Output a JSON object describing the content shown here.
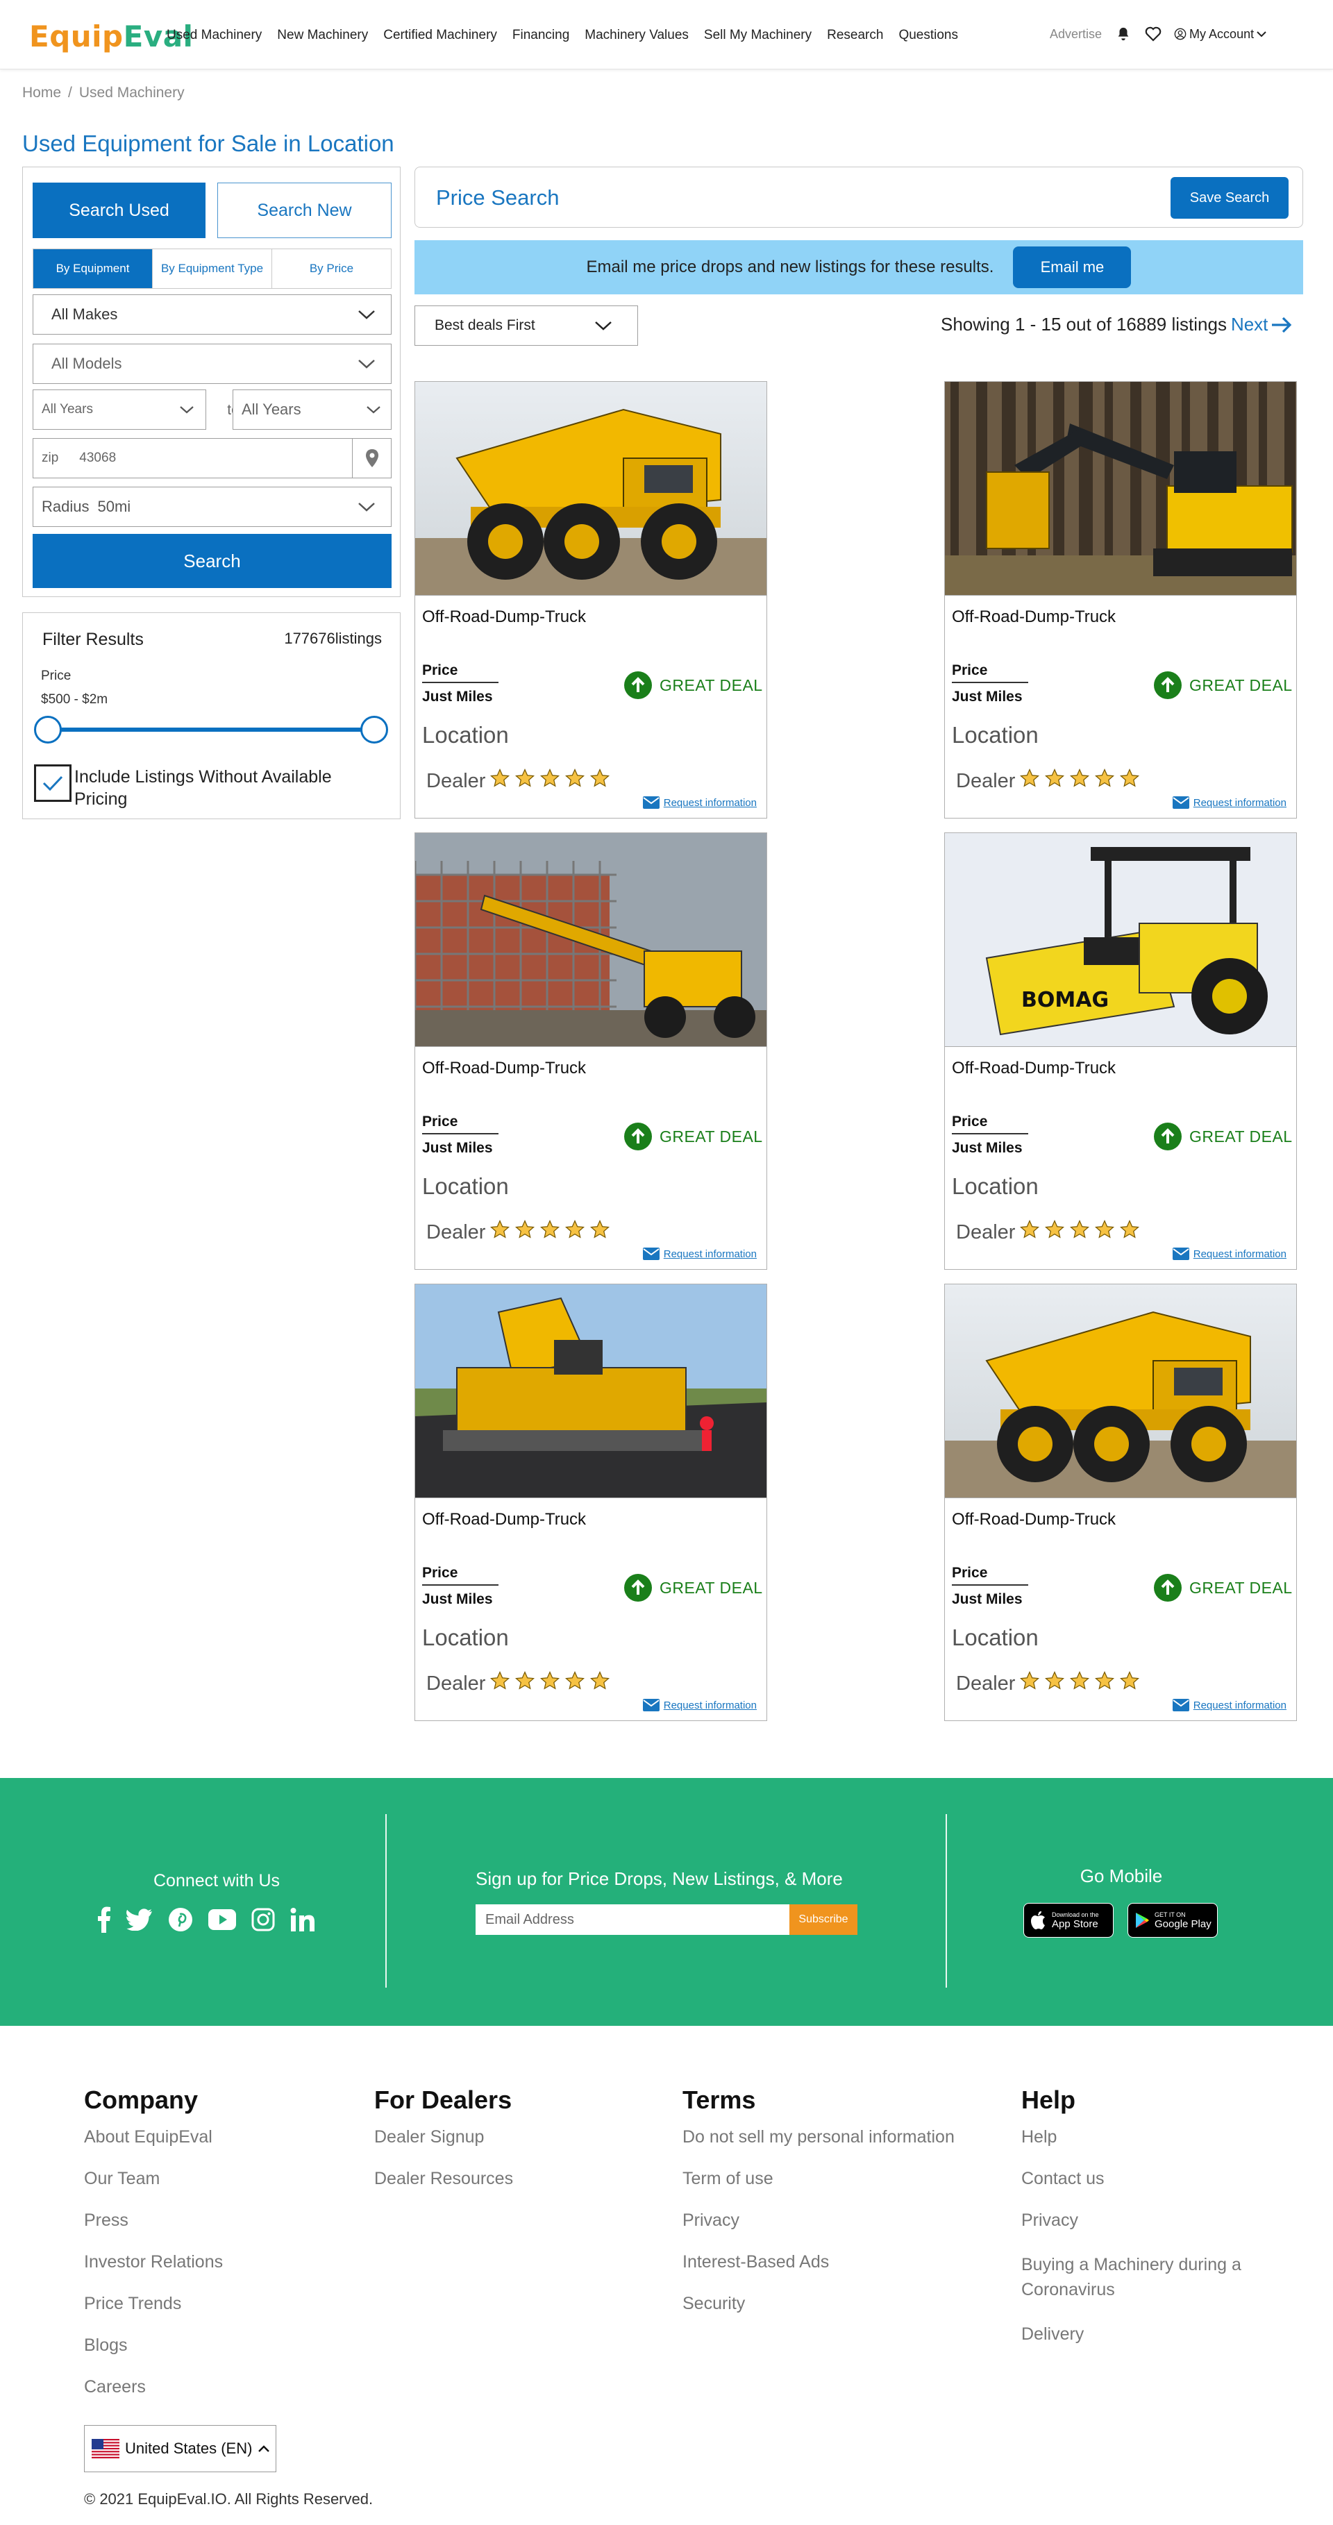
{
  "header": {
    "logo_part1": "Equip",
    "logo_part2": "Eval",
    "nav": [
      "Used Machinery",
      "New Machinery",
      "Certified Machinery",
      "Financing",
      "Machinery Values",
      "Sell My Machinery",
      "Research",
      "Questions"
    ],
    "advertise": "Advertise",
    "account": "My Account",
    "icons": [
      "bell-icon",
      "heart-icon",
      "user-icon",
      "chevron-down-icon"
    ]
  },
  "breadcrumb": {
    "home": "Home",
    "sep": "/",
    "current": "Used Machinery"
  },
  "page_title": "Used Equipment for Sale in Location",
  "search_panel": {
    "tab_used": "Search Used",
    "tab_new": "Search New",
    "subtabs": [
      "By Equipment",
      "By Equipment Type",
      "By Price"
    ],
    "makes": "All Makes",
    "models": "All Models",
    "year_from": "All Years",
    "to_label": "to",
    "year_to": "All Years",
    "zip_label": "zip",
    "zip_value": "43068",
    "radius_label": "Radius",
    "radius_value": "50mi",
    "search_button": "Search"
  },
  "filter": {
    "title": "Filter Results",
    "count": "177676listings",
    "price_label": "Price",
    "price_range": "$500 - $2m",
    "slider_min": 0,
    "slider_max": 1,
    "include_label": "Include Listings Without Available Pricing",
    "include_checked": true
  },
  "price_search": {
    "title": "Price Search",
    "save_button": "Save Search"
  },
  "email_banner": {
    "text": "Email me price drops and new listings for these results.",
    "button": "Email me"
  },
  "sort": {
    "selected": "Best deals First"
  },
  "results": {
    "showing": "Showing 1 - 15 out of 16889 listings",
    "next": "Next"
  },
  "listings": [
    {
      "title": "Off-Road-Dump-Truck",
      "price": "Price",
      "miles": "Just Miles",
      "deal": "GREAT DEAL",
      "location": "Location",
      "dealer": "Dealer",
      "stars": 5,
      "request": "Request information",
      "image": "dump-truck"
    },
    {
      "title": "Off-Road-Dump-Truck",
      "price": "Price",
      "miles": "Just Miles",
      "deal": "GREAT DEAL",
      "location": "Location",
      "dealer": "Dealer",
      "stars": 5,
      "request": "Request information",
      "image": "forestry-harvester"
    },
    {
      "title": "Off-Road-Dump-Truck",
      "price": "Price",
      "miles": "Just Miles",
      "deal": "GREAT DEAL",
      "location": "Location",
      "dealer": "Dealer",
      "stars": 5,
      "request": "Request information",
      "image": "telehandler"
    },
    {
      "title": "Off-Road-Dump-Truck",
      "price": "Price",
      "miles": "Just Miles",
      "deal": "GREAT DEAL",
      "location": "Location",
      "dealer": "Dealer",
      "stars": 5,
      "request": "Request information",
      "image": "road-roller",
      "brand": "BOMAG"
    },
    {
      "title": "Off-Road-Dump-Truck",
      "price": "Price",
      "miles": "Just Miles",
      "deal": "GREAT DEAL",
      "location": "Location",
      "dealer": "Dealer",
      "stars": 5,
      "request": "Request information",
      "image": "asphalt-paver"
    },
    {
      "title": "Off-Road-Dump-Truck",
      "price": "Price",
      "miles": "Just Miles",
      "deal": "GREAT DEAL",
      "location": "Location",
      "dealer": "Dealer",
      "stars": 5,
      "request": "Request information",
      "image": "dump-truck"
    }
  ],
  "green_footer": {
    "connect": "Connect with Us",
    "social_icons": [
      "facebook-icon",
      "twitter-icon",
      "pinterest-icon",
      "youtube-icon",
      "instagram-icon",
      "linkedin-icon"
    ],
    "signup": "Sign up for Price Drops, New Listings, & More",
    "email_placeholder": "Email Address",
    "subscribe": "Subscribe",
    "go_mobile": "Go Mobile",
    "app_store_small": "Download on the",
    "app_store_big": "App Store",
    "google_play_small": "GET IT ON",
    "google_play_big": "Google Play"
  },
  "footer": {
    "company": {
      "title": "Company",
      "links": [
        "About EquipEval",
        "Our Team",
        "Press",
        "Investor Relations",
        "Price Trends",
        "Blogs",
        "Careers"
      ]
    },
    "dealers": {
      "title": "For Dealers",
      "links": [
        "Dealer Signup",
        "Dealer Resources"
      ]
    },
    "terms": {
      "title": "Terms",
      "links": [
        "Do not sell my personal information",
        "Term of use",
        "Privacy",
        "Interest-Based Ads",
        "Security"
      ]
    },
    "help": {
      "title": "Help",
      "links": [
        "Help",
        "Contact us",
        "Privacy",
        "Buying a Machinery during a Coronavirus",
        "Delivery"
      ]
    },
    "country": "United States (EN)",
    "copyright": "© 2021 EquipEval.IO. All Rights Reserved."
  },
  "colors": {
    "primary": "#0a70c0",
    "green": "#24b07a",
    "orange": "#f0941e",
    "banner": "#90d3f7",
    "deal_green": "#1a7f1a"
  }
}
